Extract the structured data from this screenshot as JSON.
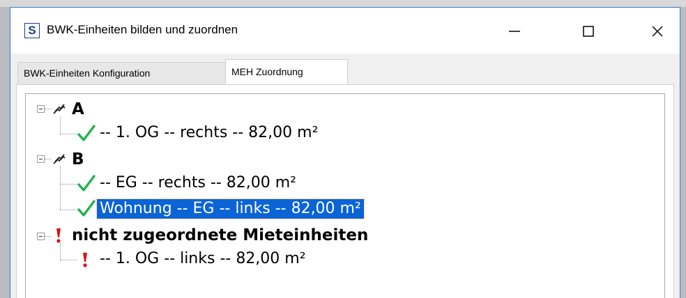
{
  "window": {
    "app_icon_letter": "S",
    "title": "BWK-Einheiten bilden und zuordnen"
  },
  "tabs": [
    {
      "label": "BWK-Einheiten Konfiguration",
      "active": false
    },
    {
      "label": "MEH Zuordnung",
      "active": true
    }
  ],
  "tree": {
    "groups": [
      {
        "label": "A",
        "icon": "stair-icon",
        "items": [
          {
            "label": "-- 1. OG -- rechts -- 82,00 m²",
            "icon": "check-icon",
            "selected": false
          }
        ]
      },
      {
        "label": "B",
        "icon": "stair-icon",
        "items": [
          {
            "label": "-- EG -- rechts -- 82,00 m²",
            "icon": "check-icon",
            "selected": false
          },
          {
            "label": "Wohnung -- EG -- links -- 82,00 m²",
            "icon": "check-icon",
            "selected": true
          }
        ]
      },
      {
        "label": "nicht zugeordnete Mieteinheiten",
        "icon": "exclamation-icon",
        "items": [
          {
            "label": "-- 1. OG -- links -- 82,00 m²",
            "icon": "exclamation-icon",
            "selected": false
          }
        ]
      }
    ]
  },
  "colors": {
    "accent": "#0a64d6",
    "check": "#22b14c",
    "warning": "#e01010",
    "border": "#2b7ad6"
  }
}
